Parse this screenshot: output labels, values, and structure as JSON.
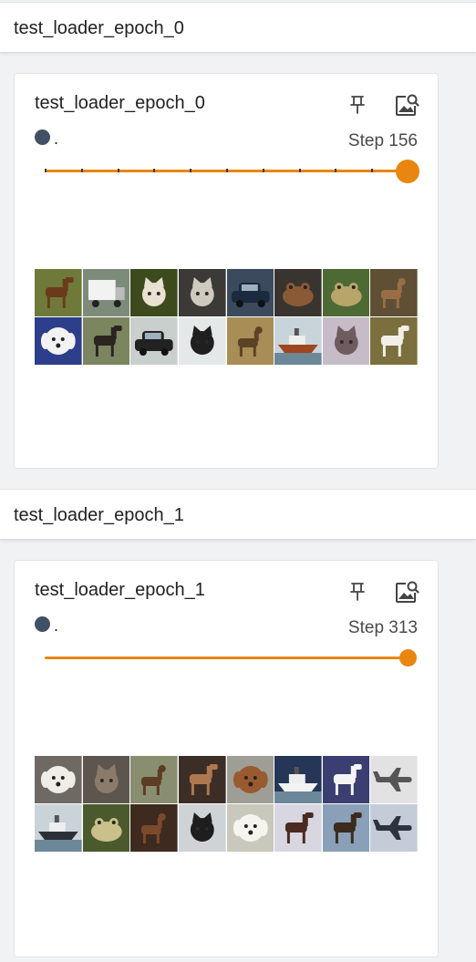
{
  "colors": {
    "accent": "#e8860f",
    "run_dot": "#425066",
    "text": "#212121",
    "muted": "#4a4a4a"
  },
  "sections": [
    {
      "header": "test_loader_epoch_0",
      "card_title": "test_loader_epoch_0",
      "run_name": ".",
      "step_label": "Step 156",
      "slider_fraction": 1.0,
      "slider_ticks": 10,
      "pin_icon": "pin-icon",
      "expand_icon": "image-search-icon",
      "image_grid": [
        {
          "subject": "horse",
          "bg": "#6f7a3a",
          "fg": "#6b3a1c"
        },
        {
          "subject": "truck",
          "bg": "#7d8c7a",
          "fg": "#f2f2f2"
        },
        {
          "subject": "cat",
          "bg": "#3d4a1e",
          "fg": "#e9e1d2"
        },
        {
          "subject": "cat",
          "bg": "#3c3a36",
          "fg": "#cfc9c0"
        },
        {
          "subject": "car",
          "bg": "#3b4a5c",
          "fg": "#1b2b3e"
        },
        {
          "subject": "frog",
          "bg": "#3a3430",
          "fg": "#8a5a36"
        },
        {
          "subject": "frog",
          "bg": "#4d6a35",
          "fg": "#b8a56a"
        },
        {
          "subject": "deer",
          "bg": "#5e4f35",
          "fg": "#9a6e45"
        },
        {
          "subject": "dog",
          "bg": "#2d3f8a",
          "fg": "#f2f2f2"
        },
        {
          "subject": "horse",
          "bg": "#7b8660",
          "fg": "#2c2420"
        },
        {
          "subject": "car",
          "bg": "#c9cfcc",
          "fg": "#222222"
        },
        {
          "subject": "cat",
          "bg": "#e5e8e8",
          "fg": "#1f1f1f"
        },
        {
          "subject": "deer",
          "bg": "#a88d56",
          "fg": "#5d4325"
        },
        {
          "subject": "ship",
          "bg": "#c8d4da",
          "fg": "#a0451f"
        },
        {
          "subject": "cat",
          "bg": "#c6bcc8",
          "fg": "#6e5c5e"
        },
        {
          "subject": "horse",
          "bg": "#7c6f3e",
          "fg": "#f2efe8"
        }
      ]
    },
    {
      "header": "test_loader_epoch_1",
      "card_title": "test_loader_epoch_1",
      "run_name": ".",
      "step_label": "Step 313",
      "slider_fraction": 1.0,
      "slider_ticks": 0,
      "pin_icon": "pin-icon",
      "expand_icon": "image-search-icon",
      "image_grid": [
        {
          "subject": "dog",
          "bg": "#6e6a63",
          "fg": "#f0ece6"
        },
        {
          "subject": "cat",
          "bg": "#5c564e",
          "fg": "#8b7b6a"
        },
        {
          "subject": "deer",
          "bg": "#8a8e70",
          "fg": "#5c3c22"
        },
        {
          "subject": "horse",
          "bg": "#3c2e26",
          "fg": "#b07850"
        },
        {
          "subject": "dog",
          "bg": "#9e9e96",
          "fg": "#9a5a30"
        },
        {
          "subject": "ship",
          "bg": "#263656",
          "fg": "#f2f2f2"
        },
        {
          "subject": "horse",
          "bg": "#3a3e70",
          "fg": "#f4f4f4"
        },
        {
          "subject": "airplane",
          "bg": "#e2e2e2",
          "fg": "#555555"
        },
        {
          "subject": "ship",
          "bg": "#c9d3d8",
          "fg": "#2c3036"
        },
        {
          "subject": "frog",
          "bg": "#4a5a2c",
          "fg": "#c9c08a"
        },
        {
          "subject": "deer",
          "bg": "#3e2a1f",
          "fg": "#7b4a2a"
        },
        {
          "subject": "cat",
          "bg": "#cfd3d6",
          "fg": "#1e1e1e"
        },
        {
          "subject": "dog",
          "bg": "#c8c8bc",
          "fg": "#f6f4ee"
        },
        {
          "subject": "horse",
          "bg": "#d8d6e0",
          "fg": "#4a2a22"
        },
        {
          "subject": "horse",
          "bg": "#8aa0b8",
          "fg": "#3c2a1c"
        },
        {
          "subject": "airplane",
          "bg": "#c4ccd8",
          "fg": "#2c3440"
        }
      ]
    }
  ]
}
